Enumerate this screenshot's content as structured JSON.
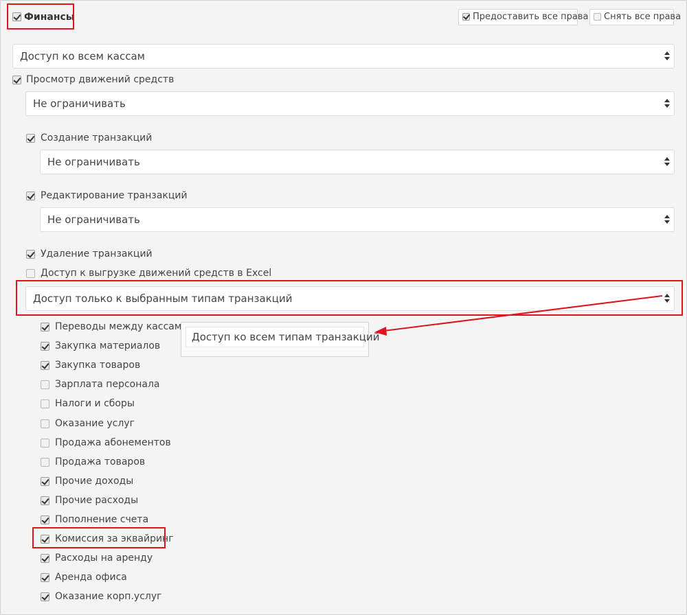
{
  "header": {
    "section_title": "Финансы",
    "grant_all_label": "Предоставить все права",
    "revoke_all_label": "Снять все права"
  },
  "cash_access_select": "Доступ ко всем кассам",
  "view_movements": {
    "label": "Просмотр движений средств",
    "select": "Не ограничивать"
  },
  "create_transactions": {
    "label": "Создание транзакций",
    "select": "Не ограничивать"
  },
  "edit_transactions": {
    "label": "Редактирование транзакций",
    "select": "Не ограничивать"
  },
  "delete_transactions": {
    "label": "Удаление транзакций"
  },
  "excel_export": {
    "label": "Доступ к выгрузке движений средств в Excel"
  },
  "transaction_types_select": "Доступ только к выбранным типам транзакций",
  "dropdown_popup_option": "Доступ ко всем типам транзакций",
  "transaction_types": [
    {
      "label": "Переводы между кассами",
      "checked": true
    },
    {
      "label": "Закупка материалов",
      "checked": true
    },
    {
      "label": "Закупка товаров",
      "checked": true
    },
    {
      "label": "Зарплата персонала",
      "checked": false
    },
    {
      "label": "Налоги и сборы",
      "checked": false
    },
    {
      "label": "Оказание услуг",
      "checked": false
    },
    {
      "label": "Продажа абонементов",
      "checked": false
    },
    {
      "label": "Продажа товаров",
      "checked": false
    },
    {
      "label": "Прочие доходы",
      "checked": true
    },
    {
      "label": "Прочие расходы",
      "checked": true
    },
    {
      "label": "Пополнение счета",
      "checked": true
    },
    {
      "label": "Комиссия за эквайринг",
      "checked": true
    },
    {
      "label": "Расходы на аренду",
      "checked": true
    },
    {
      "label": "Аренда офиса",
      "checked": true
    },
    {
      "label": "Оказание корп.услуг",
      "checked": true
    }
  ],
  "colors": {
    "highlight_red": "#e0141e",
    "background": "#f4f4f4"
  }
}
